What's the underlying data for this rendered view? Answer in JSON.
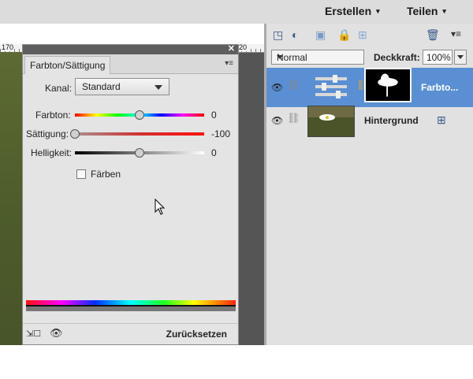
{
  "topbar": {
    "menu_create": "Erstellen",
    "menu_share": "Teilen",
    "caret": "▾",
    "close": "✕"
  },
  "ruler": {
    "left_mark": "170",
    "right_mark": "20"
  },
  "adjust_panel": {
    "tab_title": "Farbton/Sättigung",
    "channel_label": "Kanal:",
    "channel_value": "Standard",
    "hue_label": "Farbton:",
    "hue_value": "0",
    "hue_level": 0.5,
    "saturation_label": "Sättigung:",
    "saturation_value": "-100",
    "saturation_level": 0.0,
    "lightness_label": "Helligkeit:",
    "lightness_value": "0",
    "lightness_level": 0.5,
    "colorize_label": "Färben",
    "colorize_checked": false,
    "reset_label": "Zurücksetzen"
  },
  "layers_panel": {
    "blend_mode": "Normal",
    "opacity_label": "Deckkraft:",
    "opacity_value": "100%",
    "layers": [
      {
        "name": "Farbto...",
        "selected": true
      },
      {
        "name": "Hintergrund",
        "selected": false
      }
    ]
  },
  "icons": [
    "new-layer-icon",
    "adjustment-layer-icon",
    "layer-mask-icon",
    "lock-icon",
    "lock-transparency-icon",
    "trash-icon",
    "panel-menu-icon",
    "eye-icon",
    "link-icon",
    "clip-icon",
    "visibility-icon",
    "cursor-icon"
  ],
  "colors": {
    "selection": "#5a8fd3",
    "panel_bg": "#e1e1e1"
  }
}
